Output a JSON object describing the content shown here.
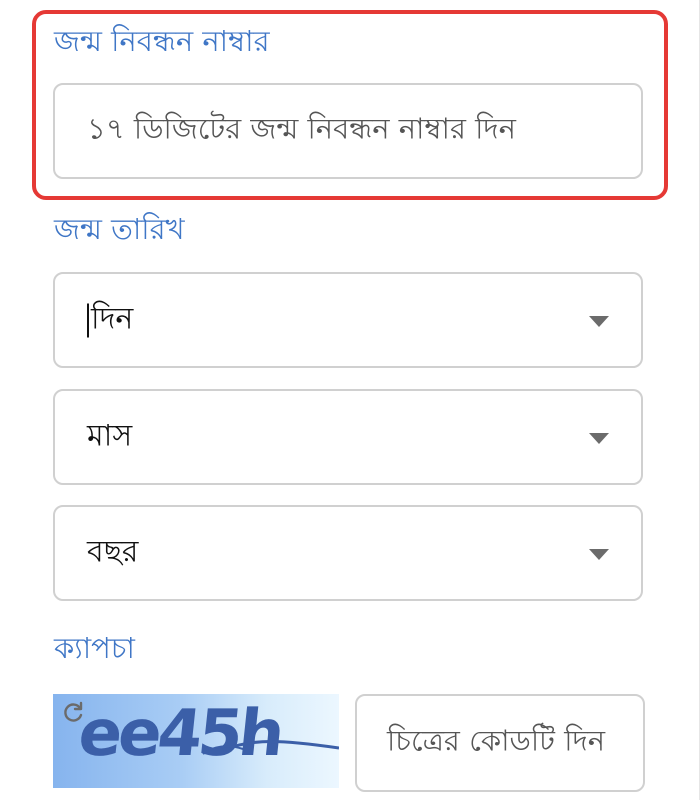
{
  "birth_registration": {
    "label": "জন্ম নিবন্ধন নাম্বার",
    "placeholder": "১৭ ডিজিটের জন্ম নিবন্ধন নাম্বার দিন"
  },
  "birth_date": {
    "label": "জন্ম তারিখ",
    "day_select": "দিন",
    "month_select": "মাস",
    "year_select": "বছর"
  },
  "captcha": {
    "label": "ক্যাপচা",
    "image_text": "ee45h",
    "input_placeholder": "চিত্রের কোডটি দিন"
  },
  "colors": {
    "label": "#3f76c6",
    "highlight": "#e53935",
    "border": "#d0d0d0"
  }
}
